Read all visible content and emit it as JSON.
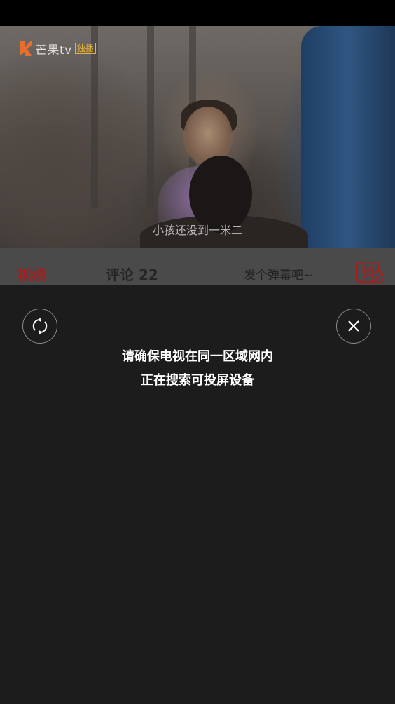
{
  "video": {
    "logo_text": "芒果tv",
    "logo_badge": "独播",
    "subtitle": "小孩还没到一米二"
  },
  "tabs": {
    "video_label": "视频",
    "comments_label": "评论 22"
  },
  "danmu": {
    "placeholder": "发个弹幕吧~",
    "button_glyph": "弹"
  },
  "cast_panel": {
    "line1": "请确保电视在同一区域网内",
    "line2": "正在搜索可投屏设备",
    "refresh_icon": "refresh-icon",
    "close_icon": "close-icon"
  },
  "colors": {
    "accent_red": "#a91d1d",
    "panel_bg": "#1c1c1c",
    "tabbar_bg": "#4a4a4a"
  }
}
